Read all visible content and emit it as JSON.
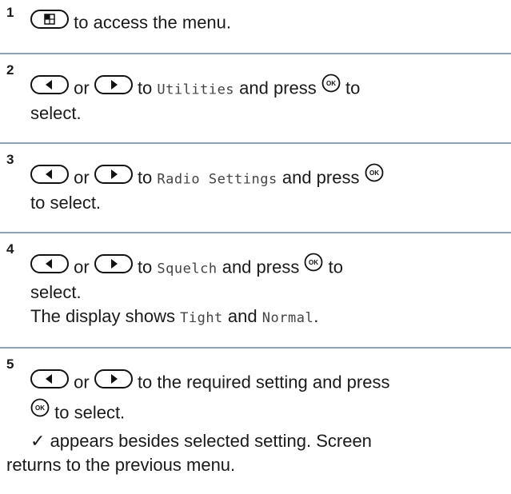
{
  "steps": [
    {
      "num": "1",
      "after_menu": "to access the menu."
    },
    {
      "num": "2",
      "or": "or",
      "to": "to",
      "item": "Utilities",
      "press": "and press",
      "to2": "to",
      "select": "select."
    },
    {
      "num": "3",
      "or": "or",
      "to": "to",
      "item": "Radio Settings",
      "press": "and press",
      "select": "to select."
    },
    {
      "num": "4",
      "or": "or",
      "to": "to",
      "item": "Squelch",
      "press": "and press",
      "to2": "to",
      "select": "select.",
      "display_pre": "The display shows",
      "opt1": "Tight",
      "and": "and",
      "opt2": "Normal",
      "period": "."
    },
    {
      "num": "5",
      "or": "or",
      "rest": "to the required setting and press",
      "select": "to select.",
      "check": "✓",
      "result1": "appears besides selected setting. Screen",
      "result2": "returns to the previous menu."
    }
  ],
  "icons": {
    "ok_label": "OK"
  }
}
